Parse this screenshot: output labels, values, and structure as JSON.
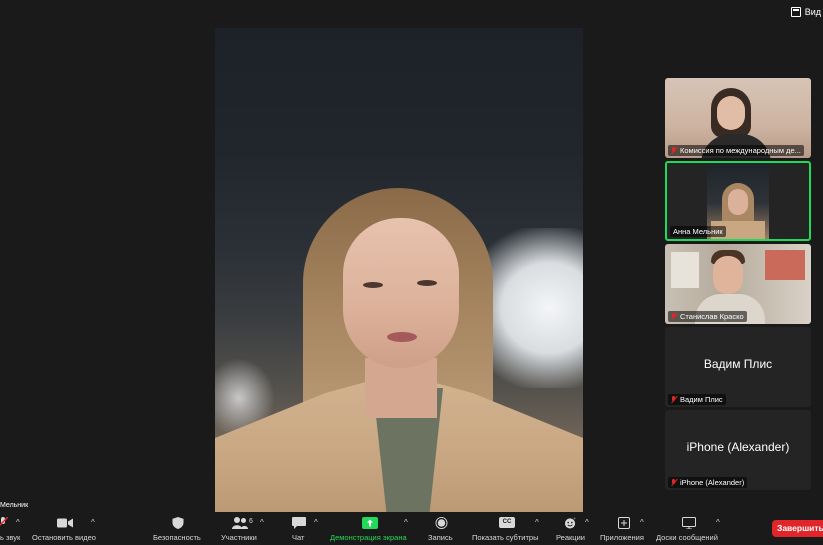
{
  "topbar": {
    "view_label": "Вид"
  },
  "main_video": {
    "participant": "Анна Мельник",
    "speaker_label_partial": "Мельник"
  },
  "sidebar": {
    "tiles": [
      {
        "name": "Комиссия по международным де...",
        "muted": true,
        "video": true
      },
      {
        "name": "Анна Мельник",
        "muted": false,
        "video": true,
        "active": true
      },
      {
        "name": "Станислав Краско",
        "muted": true,
        "video": true
      },
      {
        "name": "Вадим Плис",
        "big_name": "Вадим Плис",
        "muted": true,
        "video": false
      },
      {
        "name": "iPhone (Alexander)",
        "big_name": "iPhone (Alexander)",
        "muted": true,
        "video": false
      }
    ]
  },
  "toolbar": {
    "audio_label": "ь звук",
    "video_label": "Остановить видео",
    "security_label": "Безопасность",
    "participants_label": "Участники",
    "participants_count": "6",
    "chat_label": "Чат",
    "share_label": "Демонстрация экрана",
    "record_label": "Запись",
    "captions_label": "Показать субтитры",
    "captions_icon_text": "CC",
    "reactions_label": "Реакции",
    "apps_label": "Приложения",
    "whiteboards_label": "Доски сообщений",
    "end_label": "Завершить"
  },
  "colors": {
    "accent_green": "#23d959",
    "end_red": "#e0252b",
    "mute_red": "#e02828",
    "background": "#1a1a1a"
  }
}
